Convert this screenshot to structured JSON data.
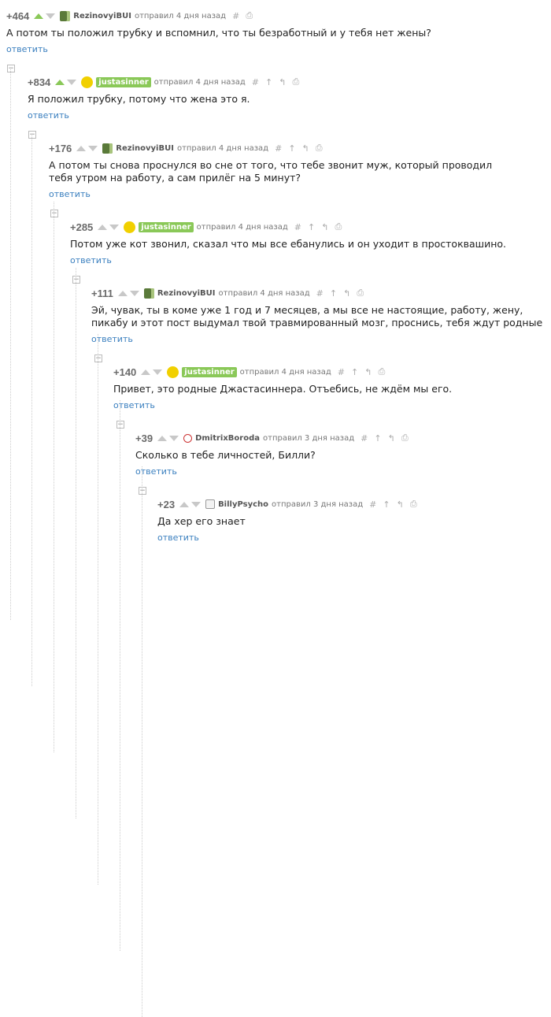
{
  "comments": [
    {
      "rating": "+464",
      "author": "RezinovyiBUI",
      "meta": "отправил 4 дня назад",
      "text": "А потом ты положил трубку и вспомнил, что ты безработный и у тебя нет жены?",
      "reply": "ответить"
    },
    {
      "rating": "+834",
      "author": "justasinner",
      "meta": "отправил 4 дня назад",
      "text": "Я положил трубку, потому что жена это я.",
      "reply": "ответить"
    },
    {
      "rating": "+176",
      "author": "RezinovyiBUI",
      "meta": "отправил 4 дня назад",
      "text": "А потом ты снова проснулся во сне от того, что тебе звонит муж, который проводил тебя утром на работу, а сам прилёг на 5 минут?",
      "reply": "ответить"
    },
    {
      "rating": "+285",
      "author": "justasinner",
      "meta": "отправил 4 дня назад",
      "text": "Потом уже кот звонил, сказал что мы все ебанулись и он уходит в простоквашино.",
      "reply": "ответить"
    },
    {
      "rating": "+111",
      "author": "RezinovyiBUI",
      "meta": "отправил 4 дня назад",
      "text": "Эй, чувак, ты в коме уже 1 год и 7 месяцев, а мы все не настоящие, работу, жену, пикабу и этот пост выдумал твой травмированный мозг, проснись, тебя ждут родные",
      "reply": "ответить"
    },
    {
      "rating": "+140",
      "author": "justasinner",
      "meta": "отправил 4 дня назад",
      "text": "Привет, это родные Джастасиннера. Отъебись, не ждём мы его.",
      "reply": "ответить"
    },
    {
      "rating": "+39",
      "author": "DmitrixBoroda",
      "meta": "отправил 3 дня назад",
      "text": "Сколько в тебе личностей, Билли?",
      "reply": "ответить"
    },
    {
      "rating": "+23",
      "author": "BillyPsycho",
      "meta": "отправил 3 дня назад",
      "text": "Да хер его знает",
      "reply": "ответить"
    }
  ],
  "icons": {
    "hash": "#",
    "arrow_up": "↑",
    "arrow_branch": "↰",
    "save": "⎙",
    "collapse": "−"
  }
}
